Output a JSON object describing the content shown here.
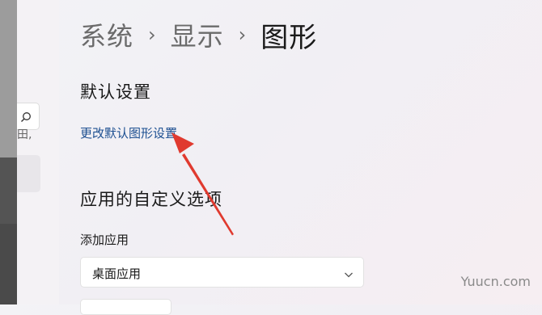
{
  "breadcrumb": {
    "items": [
      "系统",
      "显示"
    ],
    "separator": "›",
    "current": "图形"
  },
  "default_settings": {
    "heading": "默认设置",
    "link_label": "更改默认图形设置"
  },
  "custom_options": {
    "heading": "应用的自定义选项",
    "add_app_label": "添加应用",
    "app_type_selected": "桌面应用"
  },
  "sidebar": {
    "truncated_text": "田,"
  },
  "annotation": {
    "arrow_color": "#e03a2f"
  },
  "watermark": "Yuucn.com",
  "colors": {
    "link": "#1d4f91",
    "heading": "#1a1a1a",
    "muted": "#6b6b6b"
  }
}
